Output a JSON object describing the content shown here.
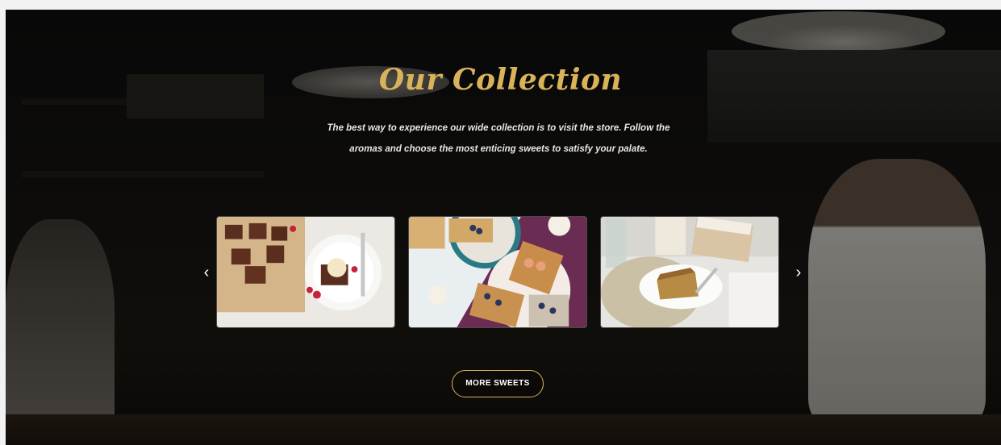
{
  "section": {
    "title": "Our Collection",
    "subtitle_line1": "The best way to experience our wide collection  is to visit the store. Follow the",
    "subtitle_line2": "aromas and choose the most enticing sweets to satisfy your palate."
  },
  "carousel": {
    "prev_icon": "chevron-left-icon",
    "next_icon": "chevron-right-icon",
    "prev_glyph": "‹",
    "next_glyph": "›",
    "items": [
      {
        "image": "brownies-with-ice-cream-photo"
      },
      {
        "image": "toasts-with-berries-photo"
      },
      {
        "image": "cake-slice-with-books-photo"
      }
    ]
  },
  "cta": {
    "label": "MORE SWEETS"
  },
  "colors": {
    "accent_gold": "#d9b35a",
    "text_light": "#e6e6e6",
    "background_dark": "#141210"
  }
}
